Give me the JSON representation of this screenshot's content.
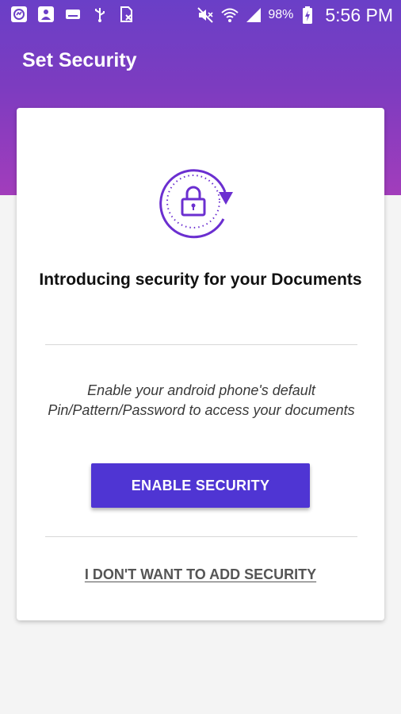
{
  "status_bar": {
    "notification_icons": [
      "messenger-icon",
      "person-icon",
      "keyboard-icon",
      "usb-icon",
      "document-x-icon"
    ],
    "system_icons": [
      "mute-icon",
      "wifi-icon",
      "signal-icon",
      "battery-charging-icon"
    ],
    "battery": "98%",
    "time": "5:56 PM"
  },
  "header": {
    "title": "Set Security"
  },
  "card": {
    "icon": "lock-rotate-icon",
    "title": "Introducing security for your Documents",
    "description": "Enable your android phone's default Pin/Pattern/Password to access your documents",
    "enable_button": "ENABLE SECURITY",
    "skip_link": "I DON'T WANT TO ADD SECURITY"
  },
  "colors": {
    "accent": "#4f35d3",
    "header_top": "#6a3fc7",
    "header_bottom": "#a23dbb",
    "lock_purple": "#6b2fd0"
  }
}
